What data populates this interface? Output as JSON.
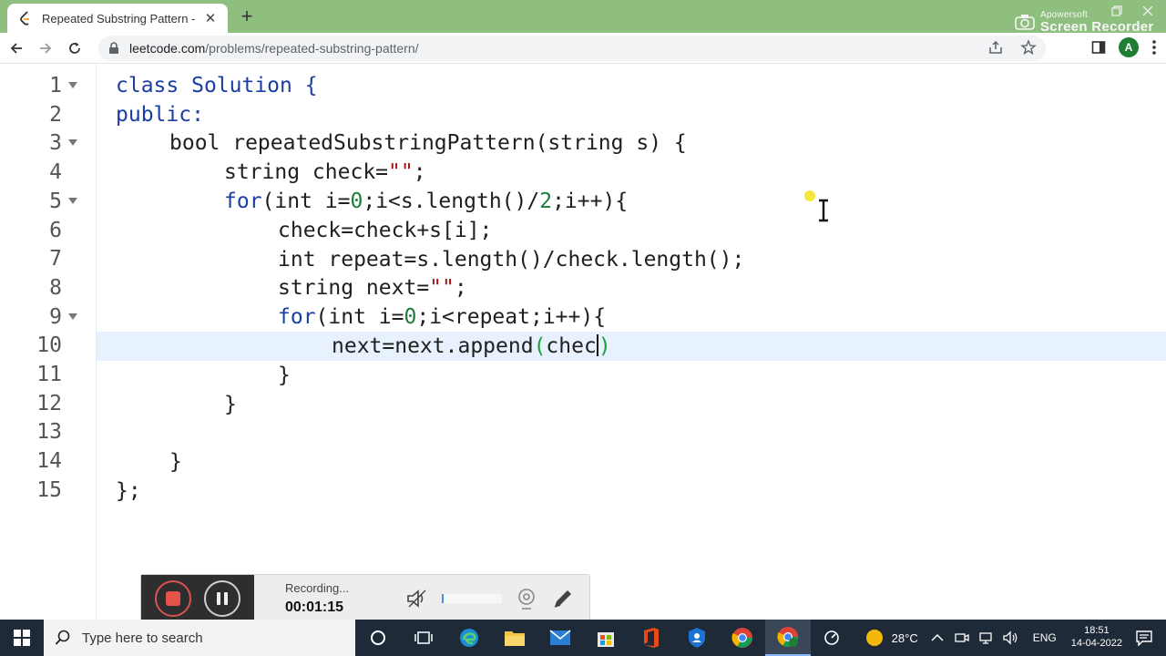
{
  "browser": {
    "tab_title": "Repeated Substring Pattern - Lee",
    "tab_close": "✕",
    "new_tab": "+",
    "url_host": "leetcode.com",
    "url_path": "/problems/repeated-substring-pattern/",
    "avatar_letter": "A"
  },
  "watermark": {
    "small": "Apowersoft",
    "big": "Screen Recorder"
  },
  "editor": {
    "lines": [
      {
        "n": "1",
        "fold": true
      },
      {
        "n": "2",
        "fold": false
      },
      {
        "n": "3",
        "fold": true
      },
      {
        "n": "4",
        "fold": false
      },
      {
        "n": "5",
        "fold": true
      },
      {
        "n": "6",
        "fold": false
      },
      {
        "n": "7",
        "fold": false
      },
      {
        "n": "8",
        "fold": false
      },
      {
        "n": "9",
        "fold": true
      },
      {
        "n": "10",
        "fold": false
      },
      {
        "n": "11",
        "fold": false
      },
      {
        "n": "12",
        "fold": false
      },
      {
        "n": "13",
        "fold": false
      },
      {
        "n": "14",
        "fold": false
      },
      {
        "n": "15",
        "fold": false
      }
    ],
    "code": {
      "l1_kw": "class",
      "l1_rest": " Solution {",
      "l2": "public:",
      "l3": "bool repeatedSubstringPattern(string s) {",
      "l4_a": "string check=",
      "l4_str": "\"\"",
      "l4_b": ";",
      "l5_kw": "for",
      "l5_a": "(int i=",
      "l5_n0": "0",
      "l5_b": ";i<s.length()/",
      "l5_n2": "2",
      "l5_c": ";i++){",
      "l6": "check=check+s[i];",
      "l7": "int repeat=s.length()/check.length();",
      "l8_a": "string next=",
      "l8_str": "\"\"",
      "l8_b": ";",
      "l9_kw": "for",
      "l9_a": "(int i=",
      "l9_n0": "0",
      "l9_b": ";i<repeat;i++){",
      "l10_a": "next=next.append",
      "l10_p1": "(",
      "l10_b": "chec",
      "l10_p2": ")",
      "l11": "}",
      "l12": "}",
      "l14": "}",
      "l15": "};"
    }
  },
  "recorder": {
    "status": "Recording...",
    "elapsed": "00:01:15"
  },
  "taskbar": {
    "search_placeholder": "Type here to search",
    "weather": "28°C",
    "language": "ENG",
    "time": "18:51",
    "date": "14-04-2022"
  }
}
